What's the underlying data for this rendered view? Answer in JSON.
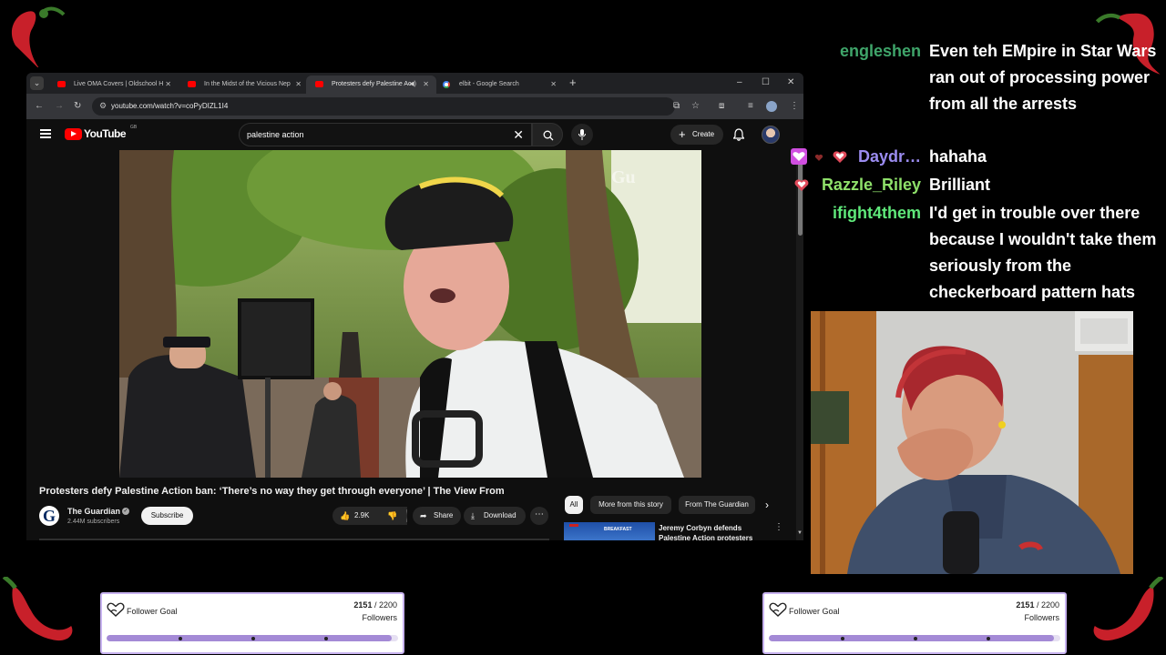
{
  "browser": {
    "tabs": [
      {
        "label": "Live OMA Covers | Oldschool H",
        "active": false
      },
      {
        "label": "In the Midst of the Vicious Nep",
        "active": false
      },
      {
        "label": "Protesters defy Palestine Ac",
        "active": true
      },
      {
        "label": "elbit - Google Search",
        "active": false
      }
    ],
    "url": "youtube.com/watch?v=coPyDIZL1I4"
  },
  "youtube": {
    "logo_text": "YouTube",
    "country_code": "GB",
    "search_query": "palestine action",
    "create_label": "Create",
    "video": {
      "title": "Protesters defy Palestine Action ban: ‘There’s no way they get through everyone’ | The View From",
      "watermark": "Gu",
      "channel_name": "The Guardian",
      "channel_initial": "G",
      "subscribers": "2.44M subscribers",
      "subscribe_label": "Subscribe",
      "likes": "2.9K",
      "share_label": "Share",
      "download_label": "Download"
    },
    "chips": [
      "All",
      "More from this story",
      "From The Guardian"
    ],
    "recommendation": {
      "title": "Jeremy Corbyn defends Palestine Action protesters",
      "thumb_label": "BREAKFAST"
    }
  },
  "chat": [
    {
      "user": "engleshen",
      "color": "#3fa56a",
      "message": "Even teh EMpire in Star Wars ran out of processing power from all the arrests"
    },
    {
      "user": "Daydr…",
      "color": "#9b8cf0",
      "message": "hahaha"
    },
    {
      "user": "Razzle_Riley",
      "color": "#8ee06a",
      "message": "Brilliant"
    },
    {
      "user": "ifight4them",
      "color": "#5fe87a",
      "message": "I'd get in trouble over there because I wouldn't take them seriously from the checkerboard pattern hats"
    }
  ],
  "goals": [
    {
      "label": "Follower Goal",
      "current": "2151",
      "target": "/ 2200",
      "unit": "Followers",
      "progress": 0.978
    },
    {
      "label": "Follower Goal",
      "current": "2151",
      "target": "/ 2200",
      "unit": "Followers",
      "progress": 0.978
    }
  ],
  "colors": {
    "accent_goal": "#a48ad6",
    "youtube_red": "#ff0000"
  }
}
